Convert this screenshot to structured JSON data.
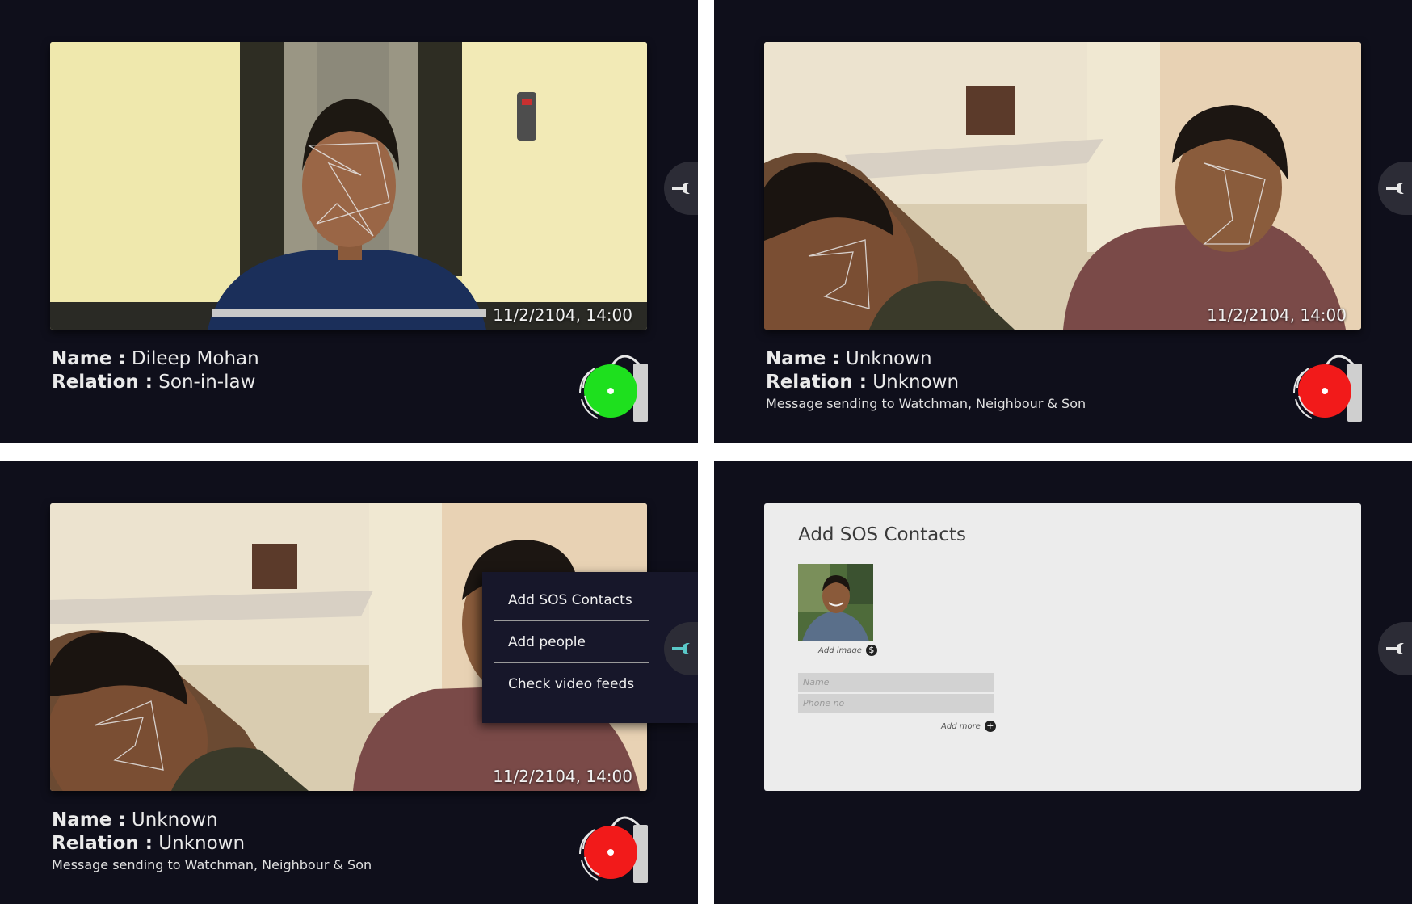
{
  "colors": {
    "panel_bg": "#0f0f1b",
    "bell_safe": "#1ee01e",
    "bell_alert": "#f21a1a",
    "accent_teal": "#5ac8c8"
  },
  "panels": [
    {
      "timestamp": "11/2/2104, 14:00",
      "name_key": "Name :",
      "name_value": "Dileep Mohan",
      "relation_key": "Relation :",
      "relation_value": "Son-in-law",
      "bell_status": "safe",
      "tool_icon": "wrench-icon"
    },
    {
      "timestamp": "11/2/2104, 14:00",
      "name_key": "Name :",
      "name_value": "Unknown",
      "relation_key": "Relation :",
      "relation_value": "Unknown",
      "message": "Message sending to Watchman, Neighbour & Son",
      "bell_status": "alert",
      "tool_icon": "wrench-icon"
    },
    {
      "timestamp": "11/2/2104, 14:00",
      "name_key": "Name :",
      "name_value": "Unknown",
      "relation_key": "Relation :",
      "relation_value": "Unknown",
      "message": "Message sending to Watchman, Neighbour & Son",
      "bell_status": "alert",
      "tool_icon": "wrench-icon",
      "menu": [
        "Add SOS Contacts",
        "Add people",
        "Check video feeds"
      ]
    },
    {
      "title": "Add SOS Contacts",
      "add_image": "Add image",
      "name_placeholder": "Name",
      "phone_placeholder": "Phone no",
      "add_more": "Add more",
      "tool_icon": "wrench-icon"
    }
  ]
}
